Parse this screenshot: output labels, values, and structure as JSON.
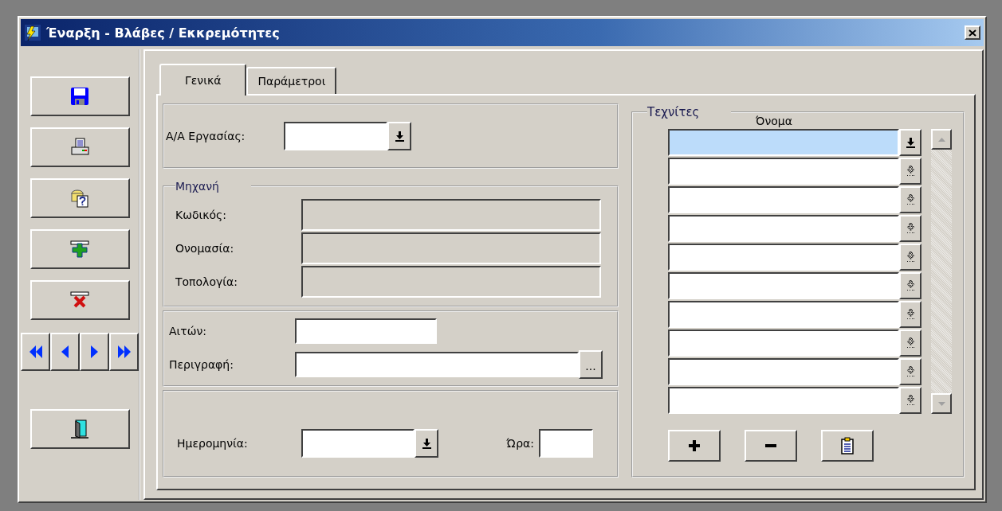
{
  "window": {
    "title": "Έναρξη - Βλάβες / Εκκρεμότητες"
  },
  "tabs": [
    {
      "label": "Γενικά",
      "selected": true
    },
    {
      "label": "Παράμετροι",
      "selected": false
    }
  ],
  "job": {
    "label": "Α/Α Εργασίας:"
  },
  "machine": {
    "title": "Μηχανή",
    "fields": [
      {
        "label": "Κωδικός:",
        "disabled": true
      },
      {
        "label": "Ονομασία:",
        "disabled": true
      },
      {
        "label": "Τοπολογία:",
        "disabled": true
      }
    ]
  },
  "request": {
    "requester_label": "Αιτών:",
    "description_label": "Περιγραφή:",
    "browse_button": "..."
  },
  "schedule": {
    "date_label": "Ημερομηνία:",
    "time_label": "Ώρα:"
  },
  "technicians": {
    "title": "Τεχνίτες",
    "column": "Όνομα",
    "rows": [
      {
        "selected": true
      },
      {
        "selected": false
      },
      {
        "selected": false
      },
      {
        "selected": false
      },
      {
        "selected": false
      },
      {
        "selected": false
      },
      {
        "selected": false
      },
      {
        "selected": false
      },
      {
        "selected": false
      },
      {
        "selected": false
      }
    ]
  }
}
